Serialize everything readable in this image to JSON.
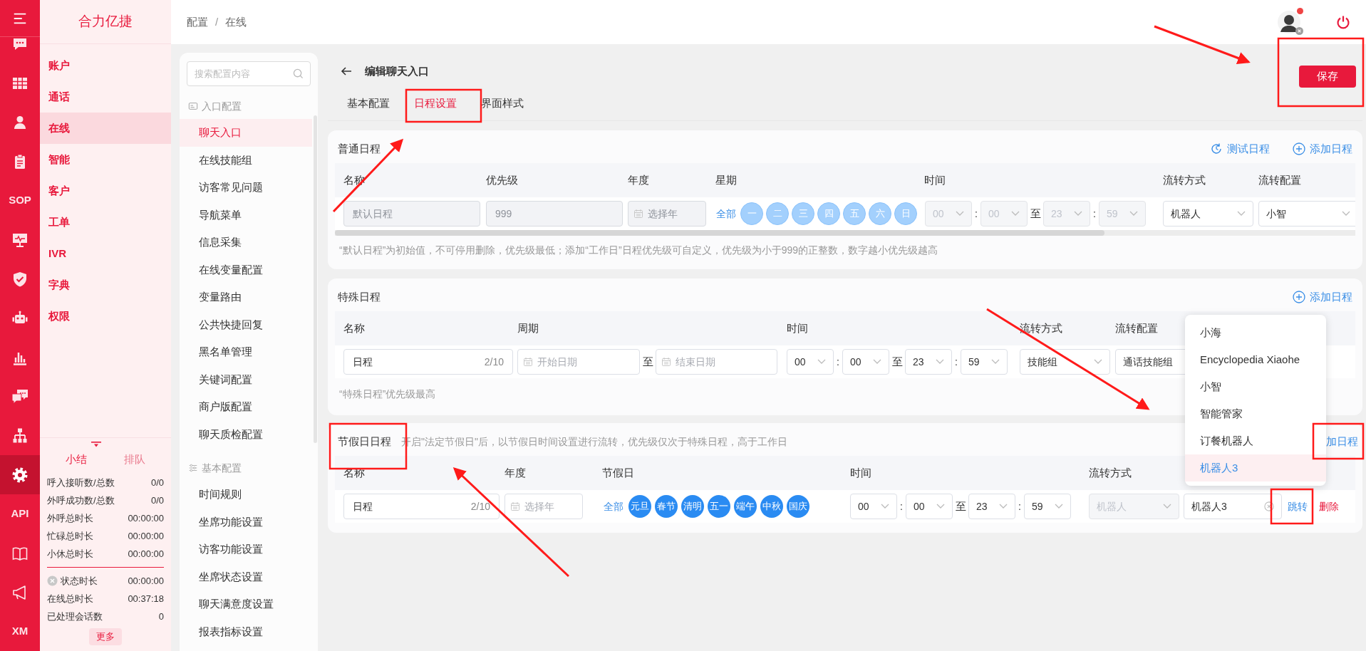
{
  "rail": [
    {
      "kind": "icon",
      "selected": false
    },
    {
      "kind": "icon",
      "selected": false
    },
    {
      "kind": "icon",
      "selected": false
    },
    {
      "kind": "icon",
      "selected": false
    },
    {
      "kind": "text",
      "label": "SOP",
      "selected": false
    },
    {
      "kind": "icon",
      "selected": false
    },
    {
      "kind": "icon",
      "selected": false
    },
    {
      "kind": "icon",
      "selected": false
    },
    {
      "kind": "icon",
      "selected": false
    },
    {
      "kind": "icon",
      "selected": false
    },
    {
      "kind": "icon",
      "selected": false
    },
    {
      "kind": "icon",
      "selected": true
    },
    {
      "kind": "text",
      "label": "API",
      "selected": false
    },
    {
      "kind": "icon",
      "selected": false
    },
    {
      "kind": "icon",
      "selected": false
    },
    {
      "kind": "text",
      "label": "XM",
      "selected": false
    }
  ],
  "brand": "合力亿捷",
  "nav": [
    {
      "label": "账户",
      "selected": false
    },
    {
      "label": "通话",
      "selected": false
    },
    {
      "label": "在线",
      "selected": true
    },
    {
      "label": "智能",
      "selected": false
    },
    {
      "label": "客户",
      "selected": false
    },
    {
      "label": "工单",
      "selected": false
    },
    {
      "label": "IVR",
      "selected": false
    },
    {
      "label": "字典",
      "selected": false
    },
    {
      "label": "权限",
      "selected": false
    }
  ],
  "summary": {
    "tabs": [
      {
        "label": "小结",
        "selected": true
      },
      {
        "label": "排队",
        "selected": false
      }
    ],
    "stats": [
      {
        "label": "呼入接听数/总数",
        "value": "0/0"
      },
      {
        "label": "外呼成功数/总数",
        "value": "0/0"
      },
      {
        "label": "外呼总时长",
        "value": "00:00:00"
      },
      {
        "label": "忙碌总时长",
        "value": "00:00:00"
      },
      {
        "label": "小休总时长",
        "value": "00:00:00"
      }
    ],
    "status": [
      {
        "label": "状态时长",
        "value": "00:00:00",
        "kind": "clearable"
      },
      {
        "label": "在线总时长",
        "value": "00:37:18",
        "kind": "plain"
      },
      {
        "label": "已处理会话数",
        "value": "0",
        "kind": "plain"
      }
    ],
    "more": "更多"
  },
  "breadcrumb": {
    "items": [
      "配置",
      "在线"
    ],
    "separator": "/"
  },
  "config_menu": {
    "search_placeholder": "搜索配置内容",
    "groups": [
      {
        "title": "入口配置",
        "kind": "entry",
        "items": [
          {
            "label": "聊天入口",
            "selected": true
          },
          {
            "label": "在线技能组",
            "selected": false
          },
          {
            "label": "访客常见问题",
            "selected": false
          },
          {
            "label": "导航菜单",
            "selected": false
          },
          {
            "label": "信息采集",
            "selected": false
          },
          {
            "label": "在线变量配置",
            "selected": false
          },
          {
            "label": "变量路由",
            "selected": false
          },
          {
            "label": "公共快捷回复",
            "selected": false
          },
          {
            "label": "黑名单管理",
            "selected": false
          },
          {
            "label": "关键词配置",
            "selected": false
          },
          {
            "label": "商户版配置",
            "selected": false
          },
          {
            "label": "聊天质检配置",
            "selected": false
          }
        ]
      },
      {
        "title": "基本配置",
        "kind": "basic",
        "items": [
          {
            "label": "时间规则",
            "selected": false
          },
          {
            "label": "坐席功能设置",
            "selected": false
          },
          {
            "label": "访客功能设置",
            "selected": false
          },
          {
            "label": "坐席状态设置",
            "selected": false
          },
          {
            "label": "聊天满意度设置",
            "selected": false
          },
          {
            "label": "报表指标设置",
            "selected": false
          }
        ]
      }
    ]
  },
  "page": {
    "title": "编辑聊天入口",
    "save": "保存",
    "tabs": [
      {
        "label": "基本配置",
        "selected": false
      },
      {
        "label": "日程设置",
        "selected": true
      },
      {
        "label": "界面样式",
        "selected": false
      }
    ]
  },
  "regular": {
    "title": "普通日程",
    "actions": [
      {
        "kind": "test",
        "label": "测试日程"
      },
      {
        "kind": "add",
        "label": "添加日程"
      }
    ],
    "columns": [
      "名称",
      "优先级",
      "年度",
      "星期",
      "时间",
      "流转方式",
      "流转配置"
    ],
    "row": {
      "name_placeholder": "默认日程",
      "priority_placeholder": "999",
      "year_placeholder": "选择年",
      "disabled": true,
      "all": "全部",
      "days": [
        {
          "label": "一",
          "selected": false
        },
        {
          "label": "二",
          "selected": false
        },
        {
          "label": "三",
          "selected": false
        },
        {
          "label": "四",
          "selected": false
        },
        {
          "label": "五",
          "selected": false
        },
        {
          "label": "六",
          "selected": false
        },
        {
          "label": "日",
          "selected": false
        }
      ],
      "time": {
        "disabled": true,
        "parts": [
          {
            "kind": "select",
            "value": "00"
          },
          {
            "kind": "sep",
            "value": ":"
          },
          {
            "kind": "select",
            "value": "00"
          },
          {
            "kind": "to",
            "value": "至"
          },
          {
            "kind": "select",
            "value": "23"
          },
          {
            "kind": "sep",
            "value": ":"
          },
          {
            "kind": "select",
            "value": "59"
          }
        ]
      },
      "mode": "机器人",
      "config": "小智"
    },
    "note": "“默认日程”为初始值，不可停用删除，优先级最低；添加“工作日”日程优先级可自定义，优先级为小于999的正整数，数字越小优先级越高"
  },
  "special": {
    "title": "特殊日程",
    "action": "添加日程",
    "columns": [
      "名称",
      "周期",
      "时间",
      "流转方式",
      "流转配置"
    ],
    "row": {
      "name": "日程",
      "count": "2/10",
      "start_placeholder": "开始日期",
      "to": "至",
      "end_placeholder": "结束日期",
      "time": {
        "disabled": false,
        "parts": [
          {
            "kind": "select",
            "value": "00"
          },
          {
            "kind": "sep",
            "value": ":"
          },
          {
            "kind": "select",
            "value": "00"
          },
          {
            "kind": "to",
            "value": "至"
          },
          {
            "kind": "select",
            "value": "23"
          },
          {
            "kind": "sep",
            "value": ":"
          },
          {
            "kind": "select",
            "value": "59"
          }
        ]
      },
      "mode": "技能组",
      "config": "通话技能组"
    },
    "note": "“特殊日程”优先级最高"
  },
  "holiday": {
    "title": "节假日日程",
    "description": "开启\"法定节假日\"后，以节假日时间设置进行流转，优先级仅次于特殊日程，高于工作日",
    "action": "加日程",
    "columns": [
      "名称",
      "年度",
      "节假日",
      "时间",
      "流转方式"
    ],
    "row": {
      "name": "日程",
      "count": "2/10",
      "year_placeholder": "选择年",
      "all": "全部",
      "holidays": [
        {
          "label": "元旦",
          "selected": true
        },
        {
          "label": "春节",
          "selected": true
        },
        {
          "label": "清明",
          "selected": true
        },
        {
          "label": "五一",
          "selected": true
        },
        {
          "label": "端午",
          "selected": true
        },
        {
          "label": "中秋",
          "selected": true
        },
        {
          "label": "国庆",
          "selected": true
        }
      ],
      "time": {
        "disabled": false,
        "parts": [
          {
            "kind": "select",
            "value": "00"
          },
          {
            "kind": "sep",
            "value": ":"
          },
          {
            "kind": "select",
            "value": "00"
          },
          {
            "kind": "to",
            "value": "至"
          },
          {
            "kind": "select",
            "value": "23"
          },
          {
            "kind": "sep",
            "value": ":"
          },
          {
            "kind": "select",
            "value": "59"
          }
        ]
      },
      "mode": "机器人",
      "mode_disabled": true,
      "config": "机器人3",
      "jump": "跳转",
      "delete": "删除"
    }
  },
  "dropdown": {
    "options": [
      {
        "label": "小海",
        "selected": false
      },
      {
        "label": "Encyclopedia Xiaohe",
        "selected": false
      },
      {
        "label": "小智",
        "selected": false
      },
      {
        "label": "智能管家",
        "selected": false
      },
      {
        "label": "订餐机器人",
        "selected": false
      },
      {
        "label": "机器人3",
        "selected": true
      }
    ]
  }
}
